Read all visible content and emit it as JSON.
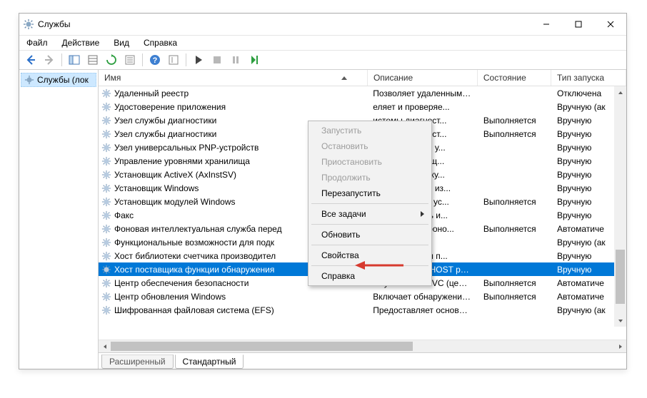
{
  "window": {
    "title": "Службы"
  },
  "menu": {
    "file": "Файл",
    "action": "Действие",
    "view": "Вид",
    "help": "Справка"
  },
  "tree": {
    "root": "Службы (лок"
  },
  "columns": {
    "name": "Имя",
    "description": "Описание",
    "state": "Состояние",
    "start_type": "Тип запуска"
  },
  "services": [
    {
      "name": "Удаленный реестр",
      "desc": "Позволяет удаленным п...",
      "state": "",
      "start": "Отключена"
    },
    {
      "name": "Удостоверение приложения",
      "desc": "еляет и проверяе...",
      "state": "",
      "start": "Вручную (ак"
    },
    {
      "name": "Узел службы диагностики",
      "desc": "истемы диагност...",
      "state": "Выполняется",
      "start": "Вручную"
    },
    {
      "name": "Узел службы диагностики",
      "desc": "истемы диагност...",
      "state": "Выполняется",
      "start": "Вручную"
    },
    {
      "name": "Узел универсальных PNP-устройств",
      "desc": "яет размещать у...",
      "state": "",
      "start": "Вручную"
    },
    {
      "name": "Управление уровнями хранилища",
      "desc": "изирует размещ...",
      "state": "",
      "start": "Вручную"
    },
    {
      "name": "Установщик ActiveX (AxInstSV)",
      "desc": "чивает проверку...",
      "state": "",
      "start": "Вручную"
    },
    {
      "name": "Установщик Windows",
      "desc": "яет добавлять, из...",
      "state": "",
      "start": "Вручную"
    },
    {
      "name": "Установщик модулей Windows",
      "desc": "яет выполнять ус...",
      "state": "Выполняется",
      "start": "Вручную"
    },
    {
      "name": "Факс",
      "desc": "яет отправлять и...",
      "state": "",
      "start": "Вручную"
    },
    {
      "name": "Фоновая интеллектуальная служба перед",
      "desc": "ает файлы в фоно...",
      "state": "Выполняется",
      "start": "Автоматиче"
    },
    {
      "name": "Функциональные возможности для подк",
      "desc": "",
      "state": "",
      "start": "Вручную (ак"
    },
    {
      "name": "Хост библиотеки счетчика производител",
      "desc": "яет удаленным п...",
      "state": "",
      "start": "Вручную"
    },
    {
      "name": "Хост поставщика функции обнаружения",
      "desc": "В службе FDPHOST разм...",
      "state": "",
      "start": "Вручную",
      "selected": true
    },
    {
      "name": "Центр обеспечения безопасности",
      "desc": "Служба WSCSVC (центр ...",
      "state": "Выполняется",
      "start": "Автоматиче"
    },
    {
      "name": "Центр обновления Windows",
      "desc": "Включает обнаружение,...",
      "state": "Выполняется",
      "start": "Автоматиче"
    },
    {
      "name": "Шифрованная файловая система (EFS)",
      "desc": "Предоставляет основну...",
      "state": "",
      "start": "Вручную (ак"
    }
  ],
  "context_menu": {
    "start": "Запустить",
    "stop": "Остановить",
    "pause": "Приостановить",
    "resume": "Продолжить",
    "restart": "Перезапустить",
    "all_tasks": "Все задачи",
    "refresh": "Обновить",
    "properties": "Свойства",
    "help": "Справка"
  },
  "tabs": {
    "extended": "Расширенный",
    "standard": "Стандартный"
  }
}
